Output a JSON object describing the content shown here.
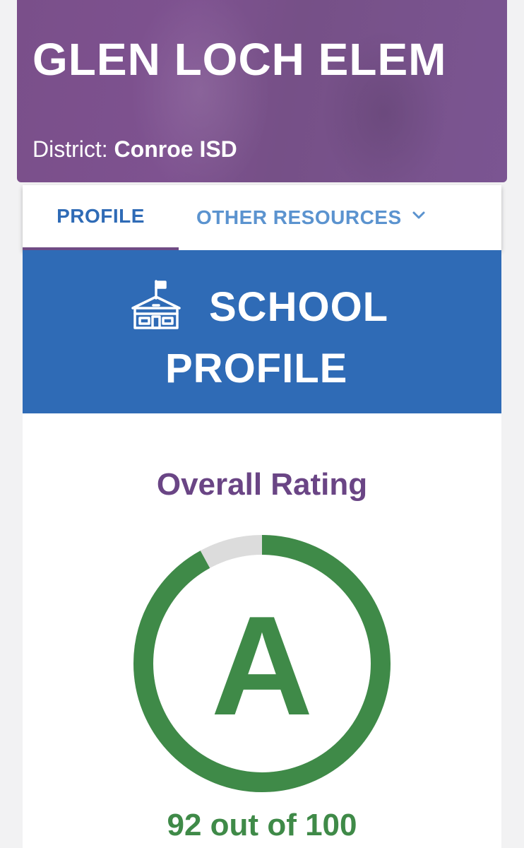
{
  "header": {
    "school_name": "GLEN LOCH ELEM",
    "district_label": "District:",
    "district_name": "Conroe ISD"
  },
  "tabs": [
    {
      "label": "PROFILE",
      "active": true
    },
    {
      "label": "OTHER RESOURCES",
      "active": false
    }
  ],
  "banner": {
    "icon": "school-building-icon",
    "title_line1": "SCHOOL",
    "title_line2": "PROFILE"
  },
  "rating": {
    "label": "Overall Rating",
    "grade": "A",
    "score_text": "92 out of 100",
    "score": 92,
    "max": 100
  },
  "colors": {
    "header_purple": "#7a4f8a",
    "tab_blue": "#2f6bb6",
    "banner_blue": "#2f6bb6",
    "rating_purple": "#6a4585",
    "grade_green": "#3f8a48",
    "gauge_track": "#dcdcdc"
  }
}
